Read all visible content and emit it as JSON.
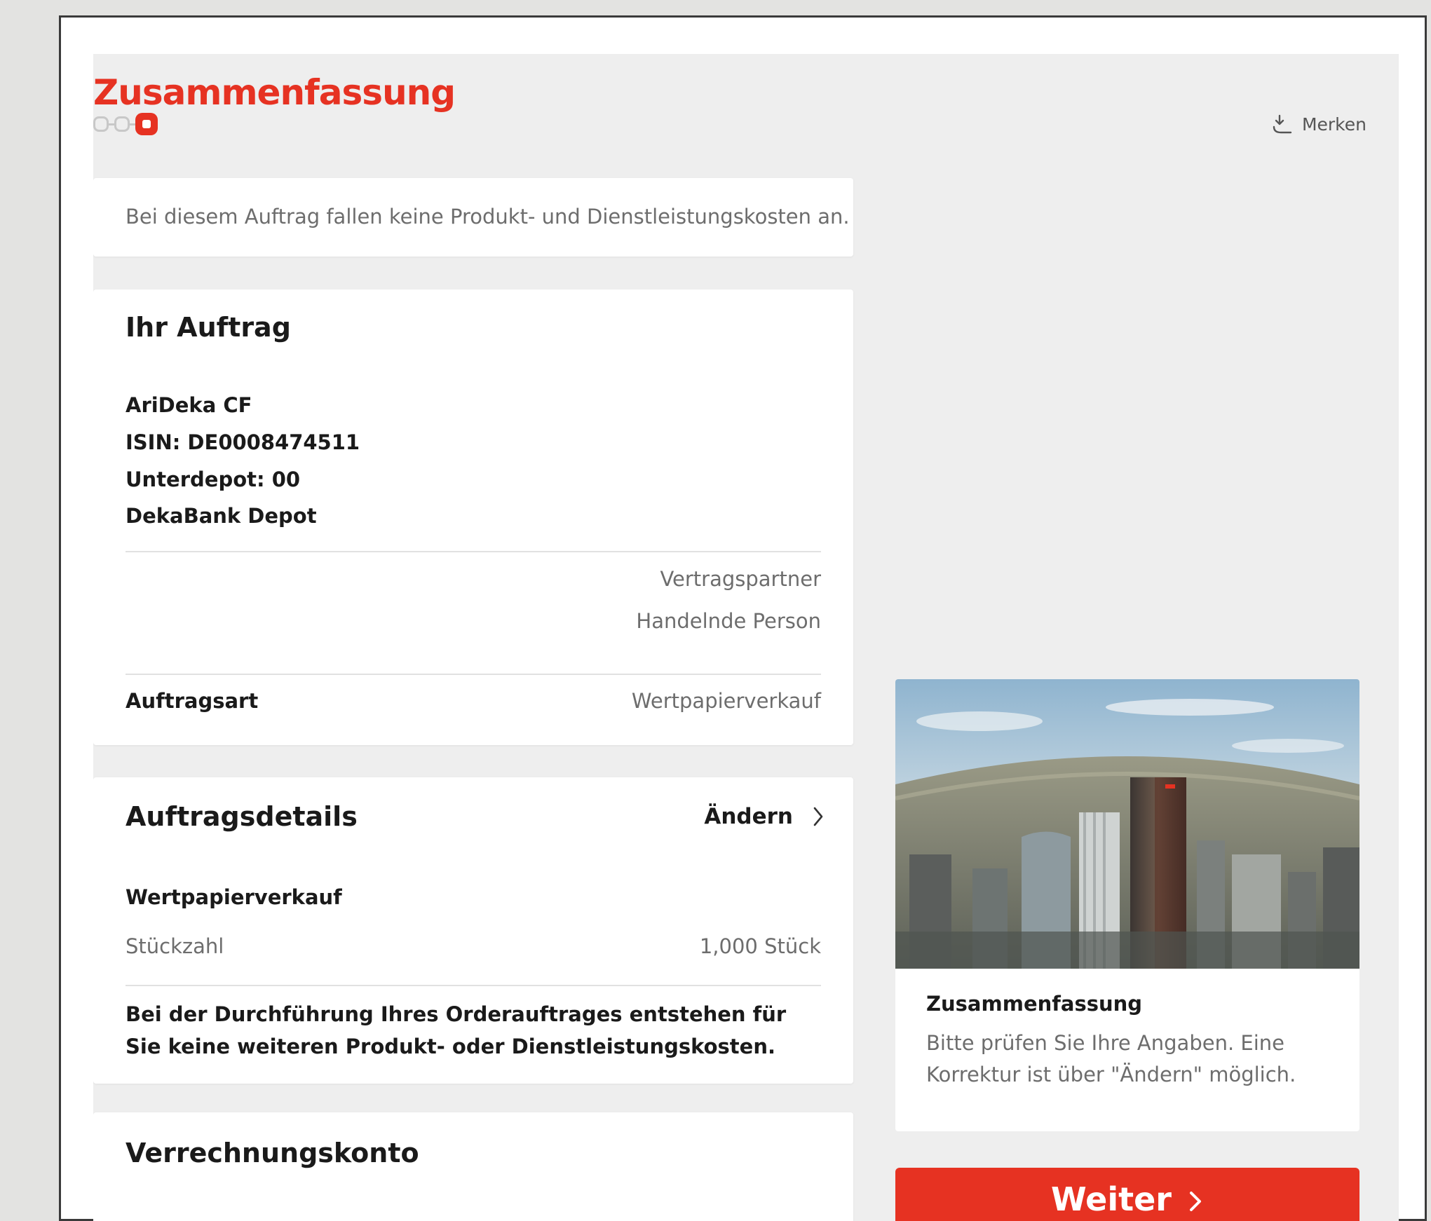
{
  "colors": {
    "accent": "#e63222",
    "panel_bg": "#eeeeee",
    "card_bg": "#ffffff",
    "muted_text": "#6d6d6d"
  },
  "header": {
    "title": "Zusammenfassung",
    "steps": {
      "total": 3,
      "current": 3
    },
    "bookmark": {
      "label": "Merken",
      "icon": "bookmark-download-icon"
    }
  },
  "notice": {
    "text": "Bei diesem Auftrag fallen keine Produkt- und Dienstleistungskosten an."
  },
  "order": {
    "heading": "Ihr Auftrag",
    "fund_name": "AriDeka CF",
    "isin": "ISIN: DE0008474511",
    "subdepot": "Unterdepot: 00",
    "depot": "DekaBank Depot",
    "role_1": "Vertragspartner",
    "role_2": "Handelnde Person",
    "type_label": "Auftragsart",
    "type_value": "Wertpapierverkauf"
  },
  "details": {
    "heading": "Auftragsdetails",
    "change_label": "Ändern",
    "change_icon": "chevron-right-icon",
    "subheading": "Wertpapierverkauf",
    "quantity_label": "Stückzahl",
    "quantity_value": "1,000 Stück",
    "cost_note": "Bei der Durchführung Ihres Orderauftrages entstehen für Sie keine weiteren Produkt- oder Dienstleistungskosten."
  },
  "settlement": {
    "heading": "Verrechnungskonto"
  },
  "sidebar": {
    "image": "city-skyline-aerial-image",
    "title": "Zusammenfassung",
    "text": "Bitte prüfen Sie Ihre Angaben. Eine Korrektur ist über \"Ändern\" möglich.",
    "button_label": "Weiter",
    "button_icon": "chevron-right-icon"
  }
}
